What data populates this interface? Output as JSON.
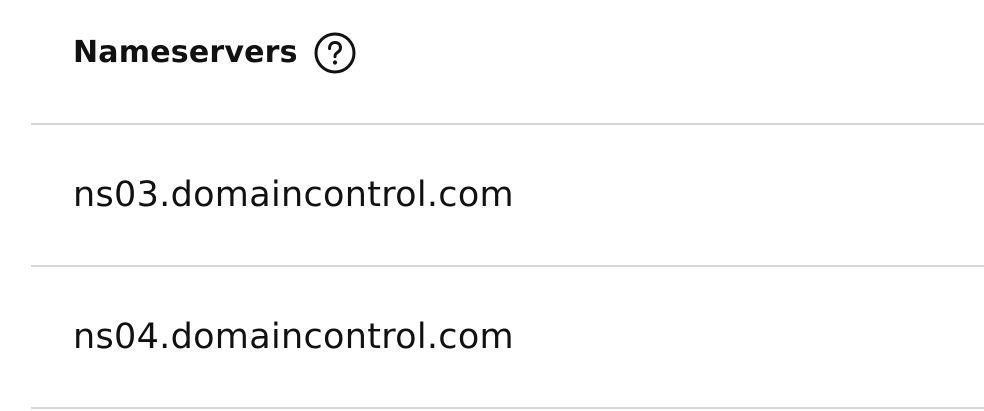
{
  "section": {
    "title": "Nameservers",
    "help_icon": "help-circle-icon"
  },
  "nameservers": [
    {
      "hostname": "ns03.domaincontrol.com"
    },
    {
      "hostname": "ns04.domaincontrol.com"
    }
  ],
  "colors": {
    "text": "#111111",
    "divider": "#d6d6d6",
    "background": "#ffffff"
  }
}
